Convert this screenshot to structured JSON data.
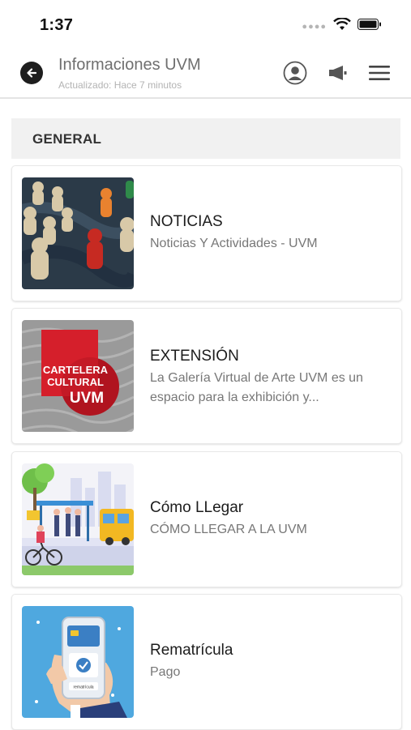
{
  "status_bar": {
    "time": "1:37"
  },
  "header": {
    "title": "Informaciones UVM",
    "subtitle": "Actualizado: Hace 7 minutos"
  },
  "section": {
    "label": "GENERAL"
  },
  "cards": [
    {
      "title": "NOTICIAS",
      "description": "Noticias Y Actividades - UVM",
      "image": "pawns-photo"
    },
    {
      "title": "EXTENSIÓN",
      "description": "La Galería Virtual de Arte UVM es un espacio para la exhibición y...",
      "image": "cartelera-cultural-logo",
      "image_text": [
        "CARTELERA",
        "CULTURAL",
        "UVM"
      ]
    },
    {
      "title": "Cómo LLegar",
      "description": "CÓMO LLEGAR A LA UVM",
      "image": "bus-stop-illustration"
    },
    {
      "title": "Rematrícula",
      "description": "Pago",
      "image": "phone-payment-illustration",
      "image_text": [
        "rematrícula"
      ]
    }
  ],
  "colors": {
    "accent_red": "#d61f2c",
    "section_bg": "#f1f1f1",
    "back_button": "#1e1e1e"
  }
}
